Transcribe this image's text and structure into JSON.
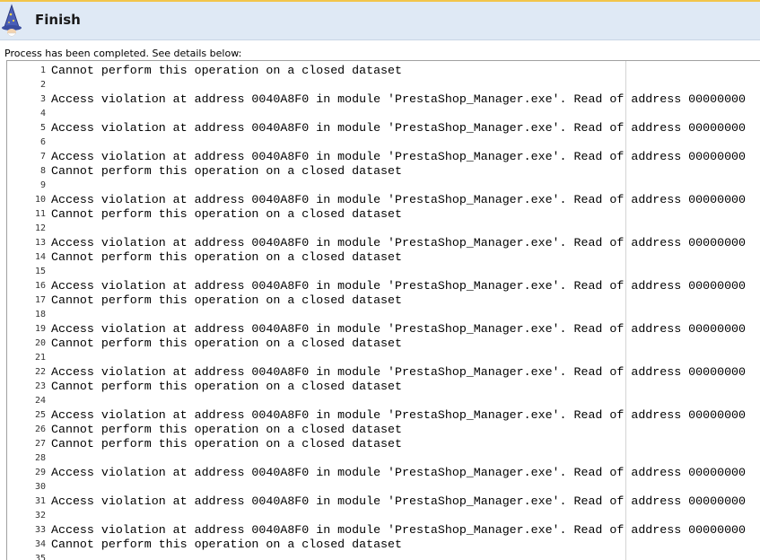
{
  "header": {
    "title": "Finish",
    "icon": "wizard-icon"
  },
  "status_text": "Process has been completed. See details below:",
  "log": [
    {
      "n": "1",
      "text": "Cannot perform this operation on a closed dataset"
    },
    {
      "n": "2",
      "text": ""
    },
    {
      "n": "3",
      "text": "Access violation at address 0040A8F0 in module 'PrestaShop_Manager.exe'. Read of address 00000000"
    },
    {
      "n": "4",
      "text": ""
    },
    {
      "n": "5",
      "text": "Access violation at address 0040A8F0 in module 'PrestaShop_Manager.exe'. Read of address 00000000"
    },
    {
      "n": "6",
      "text": ""
    },
    {
      "n": "7",
      "text": "Access violation at address 0040A8F0 in module 'PrestaShop_Manager.exe'. Read of address 00000000"
    },
    {
      "n": "8",
      "text": "Cannot perform this operation on a closed dataset"
    },
    {
      "n": "9",
      "text": ""
    },
    {
      "n": "10",
      "text": "Access violation at address 0040A8F0 in module 'PrestaShop_Manager.exe'. Read of address 00000000"
    },
    {
      "n": "11",
      "text": "Cannot perform this operation on a closed dataset"
    },
    {
      "n": "12",
      "text": ""
    },
    {
      "n": "13",
      "text": "Access violation at address 0040A8F0 in module 'PrestaShop_Manager.exe'. Read of address 00000000"
    },
    {
      "n": "14",
      "text": "Cannot perform this operation on a closed dataset"
    },
    {
      "n": "15",
      "text": ""
    },
    {
      "n": "16",
      "text": "Access violation at address 0040A8F0 in module 'PrestaShop_Manager.exe'. Read of address 00000000"
    },
    {
      "n": "17",
      "text": "Cannot perform this operation on a closed dataset"
    },
    {
      "n": "18",
      "text": ""
    },
    {
      "n": "19",
      "text": "Access violation at address 0040A8F0 in module 'PrestaShop_Manager.exe'. Read of address 00000000"
    },
    {
      "n": "20",
      "text": "Cannot perform this operation on a closed dataset"
    },
    {
      "n": "21",
      "text": ""
    },
    {
      "n": "22",
      "text": "Access violation at address 0040A8F0 in module 'PrestaShop_Manager.exe'. Read of address 00000000"
    },
    {
      "n": "23",
      "text": "Cannot perform this operation on a closed dataset"
    },
    {
      "n": "24",
      "text": ""
    },
    {
      "n": "25",
      "text": "Access violation at address 0040A8F0 in module 'PrestaShop_Manager.exe'. Read of address 00000000"
    },
    {
      "n": "26",
      "text": "Cannot perform this operation on a closed dataset"
    },
    {
      "n": "27",
      "text": "Cannot perform this operation on a closed dataset"
    },
    {
      "n": "28",
      "text": ""
    },
    {
      "n": "29",
      "text": "Access violation at address 0040A8F0 in module 'PrestaShop_Manager.exe'. Read of address 00000000"
    },
    {
      "n": "30",
      "text": ""
    },
    {
      "n": "31",
      "text": "Access violation at address 0040A8F0 in module 'PrestaShop_Manager.exe'. Read of address 00000000"
    },
    {
      "n": "32",
      "text": ""
    },
    {
      "n": "33",
      "text": "Access violation at address 0040A8F0 in module 'PrestaShop_Manager.exe'. Read of address 00000000"
    },
    {
      "n": "34",
      "text": "Cannot perform this operation on a closed dataset"
    },
    {
      "n": "35",
      "text": ""
    }
  ]
}
